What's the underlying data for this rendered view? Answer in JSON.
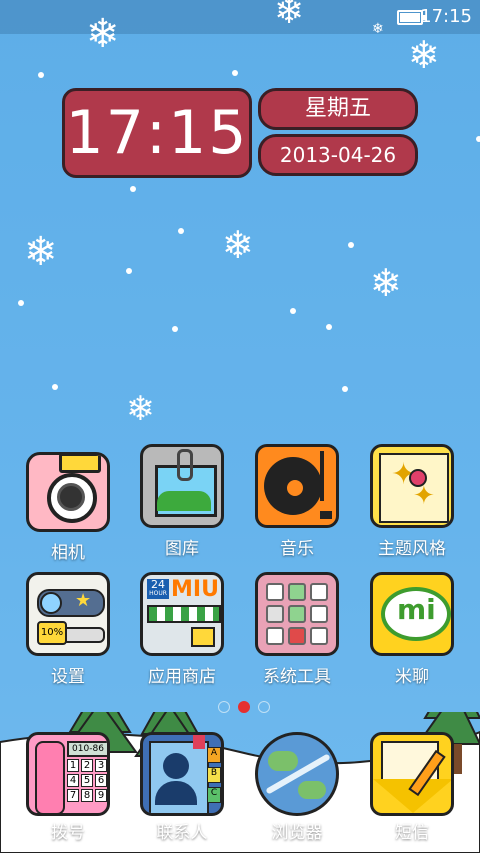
{
  "status_bar": {
    "time": "17:15"
  },
  "clock_widget": {
    "time": "17:15",
    "weekday": "星期五",
    "date": "2013-04-26"
  },
  "apps_row1": [
    {
      "label": "相机",
      "icon": "camera-icon"
    },
    {
      "label": "图库",
      "icon": "gallery-icon"
    },
    {
      "label": "音乐",
      "icon": "music-icon"
    },
    {
      "label": "主题风格",
      "icon": "theme-icon"
    }
  ],
  "apps_row2": [
    {
      "label": "设置",
      "icon": "settings-icon"
    },
    {
      "label": "应用商店",
      "icon": "app-store-icon"
    },
    {
      "label": "系统工具",
      "icon": "system-tools-icon"
    },
    {
      "label": "米聊",
      "icon": "miliao-icon"
    }
  ],
  "dock": [
    {
      "label": "拨号",
      "icon": "dialer-icon"
    },
    {
      "label": "联系人",
      "icon": "contacts-icon"
    },
    {
      "label": "浏览器",
      "icon": "browser-icon"
    },
    {
      "label": "短信",
      "icon": "messages-icon"
    }
  ],
  "icon_texts": {
    "store_badge_24": "24",
    "store_badge_hour": "HOUR",
    "store_brand": "MIUI",
    "settings_percent": "10%",
    "dialer_screen": "010-86",
    "dialer_keys": [
      "1",
      "2",
      "3",
      "4",
      "5",
      "6",
      "7",
      "8",
      "9"
    ],
    "contacts_tabs": [
      "A",
      "B",
      "C"
    ],
    "miliao_text": "mi"
  },
  "pager": {
    "pages": 3,
    "active_index": 1
  },
  "colors": {
    "accent": "#b0394b",
    "sky": "#66b4ec"
  }
}
